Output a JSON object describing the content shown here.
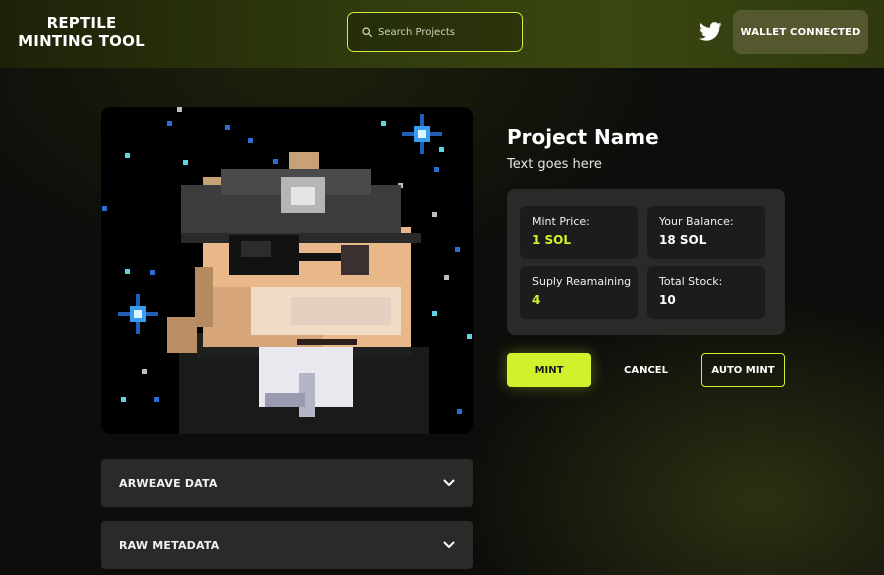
{
  "header": {
    "logo_line1": "REPTILE",
    "logo_line2": "MINTING TOOL",
    "search_placeholder": "Search Projects",
    "twitter_icon": "twitter-icon",
    "wallet_label": "WALLET CONNECTED"
  },
  "project": {
    "name": "Project Name",
    "description": "Text goes here"
  },
  "stats": [
    {
      "label": "Mint Price:",
      "value": "1 SOL",
      "value_color": "#d3f02c"
    },
    {
      "label": "Your Balance:",
      "value": "18 SOL",
      "value_color": "#ffffff"
    },
    {
      "label": "Suply Reamaining",
      "value": "4",
      "value_color": "#d3f02c"
    },
    {
      "label": "Total Stock:",
      "value": "10",
      "value_color": "#ffffff"
    }
  ],
  "actions": {
    "mint_label": "MINT",
    "cancel_label": "CANCEL",
    "auto_mint_label": "AUTO MINT"
  },
  "accordions": [
    {
      "label": "ARWEAVE DATA",
      "icon": "chevron-down-icon"
    },
    {
      "label": "RAW METADATA",
      "icon": "chevron-down-icon"
    }
  ],
  "colors": {
    "accent": "#d3f02c",
    "panel": "#2a2b29",
    "stat_card": "#1b1c1b",
    "wallet_button": "#55582f"
  }
}
